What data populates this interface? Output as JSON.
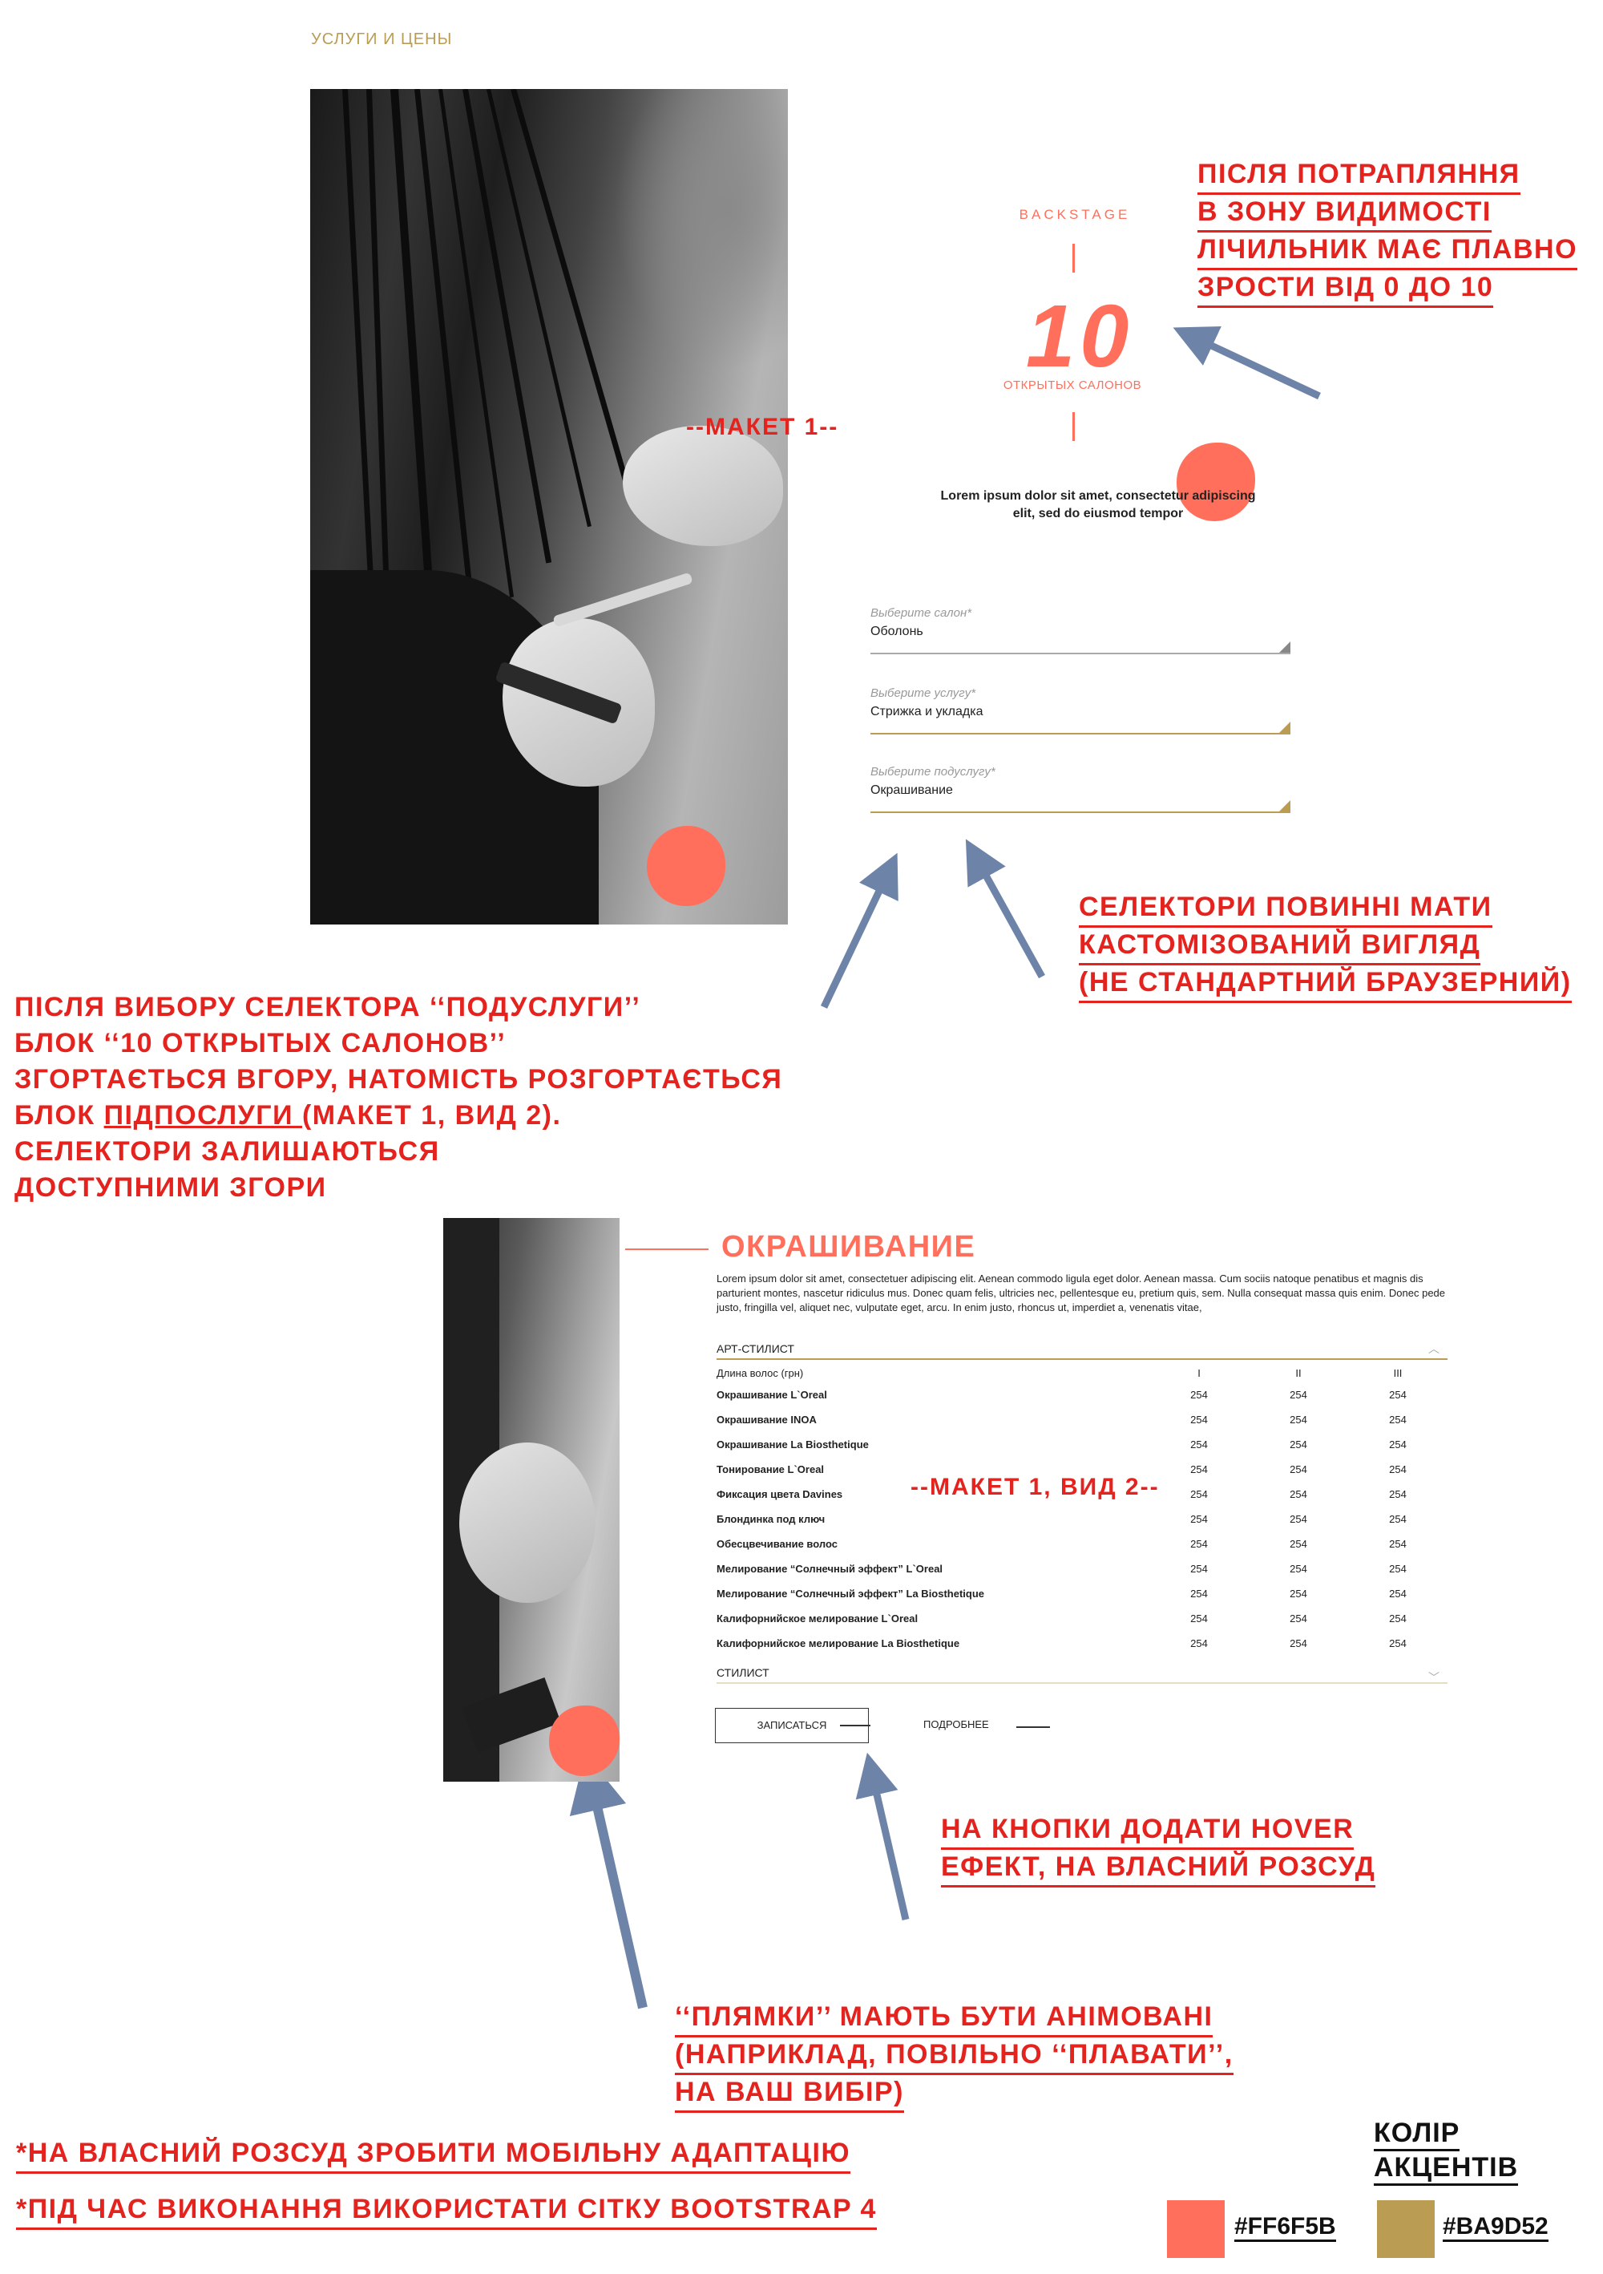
{
  "header": {
    "section_label": "УСЛУГИ И ЦЕНЫ"
  },
  "counter": {
    "label": "BACKSTAGE",
    "value": "10",
    "caption": "ОТКРЫТЫХ САЛОНОВ",
    "lorem": "Lorem ipsum dolor sit amet, consectetur adipiscing elit, sed do eiusmod tempor"
  },
  "selectors": [
    {
      "placeholder": "Выберите салон*",
      "value": "Оболонь",
      "accent": "#999999"
    },
    {
      "placeholder": "Выберите услугу*",
      "value": "Стрижка и укладка",
      "accent": "#BA9D52"
    },
    {
      "placeholder": "Выберите подуслугу*",
      "value": "Окрашивание",
      "accent": "#BA9D52"
    }
  ],
  "maket1": "--МАКЕТ 1--",
  "maket2": "--МАКЕТ 1, ВИД 2--",
  "notes": {
    "counter_note": [
      "ПІСЛЯ ПОТРАПЛЯННЯ",
      "В ЗОНУ ВИДИМОСТІ",
      "ЛІЧИЛЬНИК МАЄ ПЛАВНО",
      "ЗРОСТИ ВІД 0 ДО 10"
    ],
    "selectors_note": [
      "СЕЛЕКТОРИ ПОВИННІ МАТИ",
      "КАСТОМІЗОВАНИЙ ВИГЛЯД",
      "(НЕ СТАНДАРТНИЙ БРАУЗЕРНИЙ)"
    ],
    "subservice_note": {
      "line1": "ПІСЛЯ ВИБОРУ СЕЛЕКТОРА  ‘‘ПОДУСЛУГИ’’",
      "line2": "БЛОК ‘‘10 ОТКРЫТЫХ САЛОНОВ’’",
      "line3": "ЗГОРТАЄТЬСЯ ВГОРУ, НАТОМІСТЬ РОЗГОРТАЄТЬСЯ",
      "line4_pre": "БЛОК ",
      "line4_u": "ПІДПОСЛУГИ ",
      "line4_post": "(МАКЕТ 1, ВИД 2).",
      "line5": "СЕЛЕКТОРИ ЗАЛИШАЮТЬСЯ",
      "line6": "ДОСТУПНИМИ ЗГОРИ"
    },
    "hover_note": [
      "НА КНОПКИ ДОДАТИ HOVER",
      "ЕФЕКТ, НА ВЛАСНИЙ РОЗСУД"
    ],
    "blobs_note": [
      "‘‘ПЛЯМКИ’’ МАЮТЬ БУТИ АНІМОВАНІ",
      "(НАПРИКЛАД, ПОВІЛЬНО ‘‘ПЛАВАТИ’’,",
      "НА ВАШ ВИБІР)"
    ],
    "mobile_note": "*НА ВЛАСНИЙ РОЗСУД ЗРОБИТИ МОБІЛЬНУ АДАПТАЦІЮ",
    "bootstrap_note": "*ПІД ЧАС ВИКОНАННЯ ВИКОРИСТАТИ СІТКУ BOOTSTRAP 4"
  },
  "service": {
    "title": "ОКРАШИВАНИЕ",
    "description": "Lorem ipsum dolor sit amet, consectetuer adipiscing elit. Aenean commodo ligula eget dolor. Aenean massa. Cum sociis natoque penatibus et magnis dis parturient montes, nascetur ridiculus mus. Donec quam felis, ultricies nec, pellentesque eu, pretium quis, sem. Nulla consequat massa quis enim. Donec pede justo, fringilla vel, aliquet nec, vulputate eget, arcu. In enim justo, rhoncus ut, imperdiet a, venenatis vitae,",
    "category1": "АРТ-СТИЛИСТ",
    "category2": "СТИЛИСТ",
    "table": {
      "headers": [
        "Длина волос (грн)",
        "I",
        "II",
        "III"
      ],
      "rows": [
        [
          "Окрашивание L`Oreal",
          "254",
          "254",
          "254"
        ],
        [
          "Окрашивание INOA",
          "254",
          "254",
          "254"
        ],
        [
          "Окрашивание La Biosthetique",
          "254",
          "254",
          "254"
        ],
        [
          "Тонирование  L`Oreal",
          "254",
          "254",
          "254"
        ],
        [
          "Фиксация цвета Davines",
          "254",
          "254",
          "254"
        ],
        [
          "Блондинка под ключ",
          "254",
          "254",
          "254"
        ],
        [
          "Обесцвечивание волос",
          "254",
          "254",
          "254"
        ],
        [
          "Мелирование “Солнечный эффект”  L`Oreal",
          "254",
          "254",
          "254"
        ],
        [
          "Мелирование “Солнечный эффект” La Biosthetique",
          "254",
          "254",
          "254"
        ],
        [
          "Калифорнийское мелирование  L`Oreal",
          "254",
          "254",
          "254"
        ],
        [
          "Калифорнийское мелирование La Biosthetique",
          "254",
          "254",
          "254"
        ]
      ]
    },
    "book_button": "ЗАПИСАТЬСЯ",
    "more_button": "ПОДРОБНЕЕ"
  },
  "accents": {
    "title_line1": "КОЛІР",
    "title_line2": "АКЦЕНТІВ",
    "colors": [
      {
        "hex": "#FF6F5B"
      },
      {
        "hex": "#BA9D52"
      }
    ]
  }
}
